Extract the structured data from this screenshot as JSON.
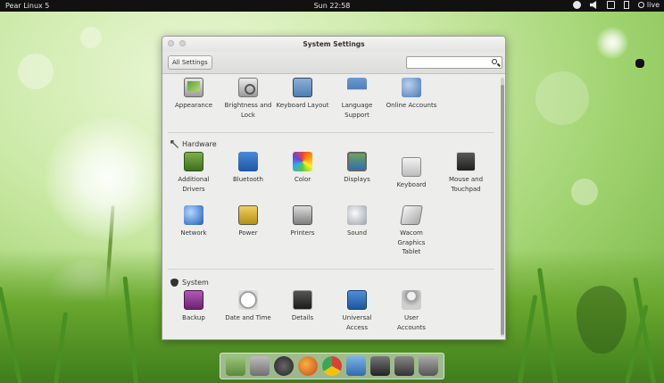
{
  "topbar": {
    "app_name": "Pear Linux 5",
    "clock": "Sun 22:58",
    "user": "live"
  },
  "window": {
    "title": "System Settings",
    "all_settings_label": "All Settings",
    "search_placeholder": ""
  },
  "sections": {
    "personal": {
      "items": [
        {
          "label": "Appearance",
          "icon": "appearance-icon"
        },
        {
          "label": "Brightness and Lock",
          "icon": "brightness-lock-icon"
        },
        {
          "label": "Keyboard Layout",
          "icon": "keyboard-layout-icon"
        },
        {
          "label": "Language Support",
          "icon": "language-support-icon"
        },
        {
          "label": "Online Accounts",
          "icon": "online-accounts-icon"
        }
      ]
    },
    "hardware": {
      "title": "Hardware",
      "items": [
        {
          "label": "Additional Drivers",
          "icon": "additional-drivers-icon"
        },
        {
          "label": "Bluetooth",
          "icon": "bluetooth-icon"
        },
        {
          "label": "Color",
          "icon": "color-icon"
        },
        {
          "label": "Displays",
          "icon": "displays-icon"
        },
        {
          "label": "Keyboard",
          "icon": "keyboard-icon"
        },
        {
          "label": "Mouse and Touchpad",
          "icon": "mouse-touchpad-icon"
        },
        {
          "label": "Network",
          "icon": "network-icon"
        },
        {
          "label": "Power",
          "icon": "power-icon"
        },
        {
          "label": "Printers",
          "icon": "printers-icon"
        },
        {
          "label": "Sound",
          "icon": "sound-icon"
        },
        {
          "label": "Wacom Graphics Tablet",
          "icon": "wacom-tablet-icon"
        }
      ]
    },
    "system": {
      "title": "System",
      "items": [
        {
          "label": "Backup",
          "icon": "backup-icon"
        },
        {
          "label": "Date and Time",
          "icon": "date-time-icon"
        },
        {
          "label": "Details",
          "icon": "details-icon"
        },
        {
          "label": "Universal Access",
          "icon": "universal-access-icon"
        },
        {
          "label": "User Accounts",
          "icon": "user-accounts-icon"
        }
      ]
    }
  },
  "dock": {
    "items": [
      {
        "icon": "display-icon",
        "color": "#7aa05a"
      },
      {
        "icon": "tools-icon",
        "color": "#8a8a8a"
      },
      {
        "icon": "launcher-icon",
        "color": "#3a3a3a"
      },
      {
        "icon": "firefox-icon",
        "color": "#e2742b"
      },
      {
        "icon": "chrome-icon",
        "color": "#d8413a"
      },
      {
        "icon": "photos-icon",
        "color": "#4c86c6"
      },
      {
        "icon": "video-icon",
        "color": "#444444"
      },
      {
        "icon": "settings-icon",
        "color": "#555555"
      },
      {
        "icon": "trash-icon",
        "color": "#6a6a6a"
      }
    ]
  }
}
